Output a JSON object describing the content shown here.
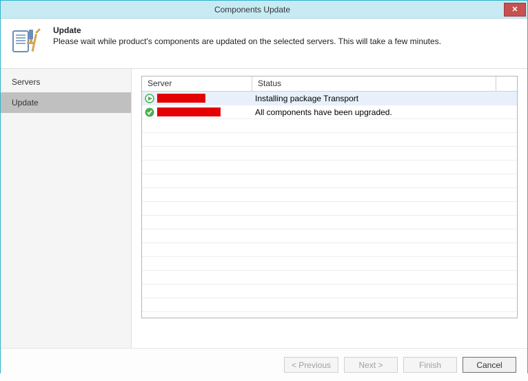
{
  "window": {
    "title": "Components Update"
  },
  "header": {
    "title": "Update",
    "description": "Please wait while product's components are updated on the selected servers. This will take a few minutes."
  },
  "sidebar": {
    "items": [
      {
        "label": "Servers",
        "active": false
      },
      {
        "label": "Update",
        "active": true
      }
    ]
  },
  "grid": {
    "columns": {
      "server": "Server",
      "status": "Status"
    },
    "rows": [
      {
        "icon": "play",
        "server_redacted_width": 70,
        "status": "Installing package Transport",
        "selected": true
      },
      {
        "icon": "check",
        "server_redacted_width": 92,
        "status": "All components have been upgraded.",
        "selected": false
      }
    ]
  },
  "buttons": {
    "previous": "< Previous",
    "next": "Next >",
    "finish": "Finish",
    "cancel": "Cancel"
  }
}
